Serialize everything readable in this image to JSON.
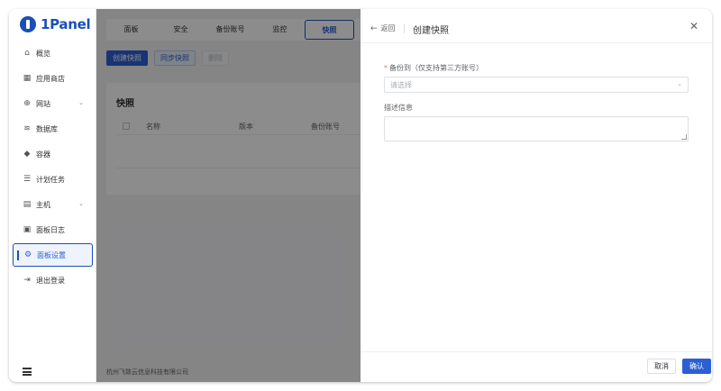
{
  "logo": {
    "text": "1Panel"
  },
  "sidebar": {
    "items": [
      {
        "label": "概览",
        "icon": "home-icon"
      },
      {
        "label": "应用商店",
        "icon": "apps-icon"
      },
      {
        "label": "网站",
        "icon": "globe-icon",
        "expandable": true
      },
      {
        "label": "数据库",
        "icon": "database-icon"
      },
      {
        "label": "容器",
        "icon": "docker-icon"
      },
      {
        "label": "计划任务",
        "icon": "list-icon"
      },
      {
        "label": "主机",
        "icon": "server-icon",
        "expandable": true
      },
      {
        "label": "面板日志",
        "icon": "log-icon"
      },
      {
        "label": "面板设置",
        "icon": "settings-icon",
        "active": true
      },
      {
        "label": "退出登录",
        "icon": "logout-icon"
      }
    ]
  },
  "tabs": [
    {
      "label": "面板"
    },
    {
      "label": "安全"
    },
    {
      "label": "备份账号"
    },
    {
      "label": "监控"
    },
    {
      "label": "快照",
      "active": true
    }
  ],
  "toolbar": {
    "create_label": "创建快照",
    "sync_label": "同步快照",
    "delete_label": "删除"
  },
  "card": {
    "title": "快照",
    "columns": [
      "名称",
      "版本",
      "备份账号"
    ]
  },
  "footer": {
    "company": "杭州飞致云信息科技有限公司"
  },
  "drawer": {
    "back_label": "返回",
    "title": "创建快照",
    "backup_label": "备份到（仅支持第三方账号）",
    "select_placeholder": "请选择",
    "desc_label": "描述信息",
    "cancel_label": "取消",
    "confirm_label": "确认"
  },
  "colors": {
    "brand": "#1a4fb8",
    "primary": "#2c5fd4",
    "required": "#f56c6c"
  }
}
